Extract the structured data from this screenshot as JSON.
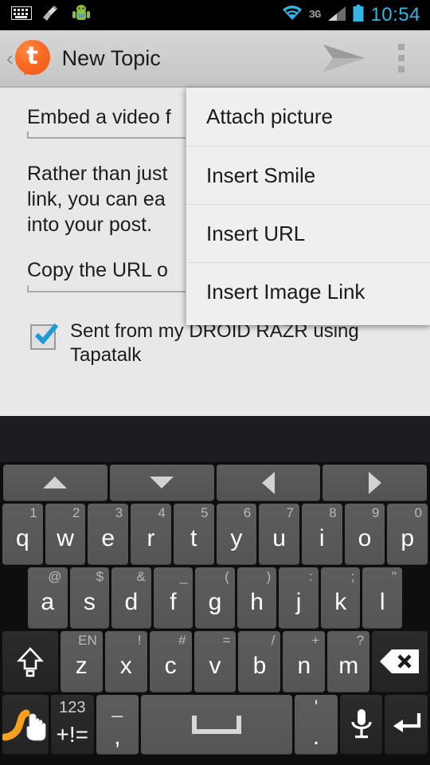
{
  "status_bar": {
    "left_icons": [
      "keyboard-icon",
      "broom-icon",
      "android-robot-icon"
    ],
    "wifi_icon": "wifi-icon",
    "network_label": "3G",
    "signal_icon": "signal-bars-icon",
    "battery_icon": "battery-icon",
    "time": "10:54",
    "accent_color": "#33b5e5"
  },
  "action_bar": {
    "back_label": "‹",
    "logo_letter": "t",
    "logo_name": "tapatalk-logo",
    "logo_color": "#f4601c",
    "title": "New Topic",
    "send_label": "send-icon",
    "overflow_label": "overflow-menu-icon"
  },
  "compose": {
    "subject": "Embed a video f",
    "body_lines": [
      "Rather than just",
      "link, you can ea",
      "into your post."
    ],
    "url_field": "Copy the URL o",
    "signature_checked": true,
    "signature_label": "Sent from my DROID RAZR using Tapatalk"
  },
  "overflow_menu": {
    "items": [
      {
        "label": "Attach picture"
      },
      {
        "label": "Insert Smile"
      },
      {
        "label": "Insert URL"
      },
      {
        "label": "Insert Image Link"
      }
    ]
  },
  "keyboard": {
    "nav_keys": [
      {
        "name": "arrow-up-key"
      },
      {
        "name": "arrow-down-key"
      },
      {
        "name": "arrow-left-key"
      },
      {
        "name": "arrow-right-key"
      }
    ],
    "row1": [
      {
        "main": "q",
        "alt": "1"
      },
      {
        "main": "w",
        "alt": "2"
      },
      {
        "main": "e",
        "alt": "3"
      },
      {
        "main": "r",
        "alt": "4"
      },
      {
        "main": "t",
        "alt": "5"
      },
      {
        "main": "y",
        "alt": "6"
      },
      {
        "main": "u",
        "alt": "7"
      },
      {
        "main": "i",
        "alt": "8"
      },
      {
        "main": "o",
        "alt": "9"
      },
      {
        "main": "p",
        "alt": "0"
      }
    ],
    "row2": [
      {
        "main": "a",
        "alt": "@"
      },
      {
        "main": "s",
        "alt": "$"
      },
      {
        "main": "d",
        "alt": "&"
      },
      {
        "main": "f",
        "alt": "_"
      },
      {
        "main": "g",
        "alt": "("
      },
      {
        "main": "h",
        "alt": ")"
      },
      {
        "main": "j",
        "alt": ":"
      },
      {
        "main": "k",
        "alt": ";"
      },
      {
        "main": "l",
        "alt": "\""
      }
    ],
    "row3": [
      {
        "main": "z",
        "alt": "EN"
      },
      {
        "main": "x",
        "alt": "!"
      },
      {
        "main": "c",
        "alt": "#"
      },
      {
        "main": "v",
        "alt": "="
      },
      {
        "main": "b",
        "alt": "/"
      },
      {
        "main": "n",
        "alt": "+"
      },
      {
        "main": "m",
        "alt": "?"
      }
    ],
    "shift_key": "shift-key",
    "backspace_key": "backspace-key",
    "swipe_key": "swipe-gesture-key",
    "symbols_key": {
      "top": "123",
      "bottom": "+!="
    },
    "comma_key": {
      "top": "_",
      "bottom": ","
    },
    "space_key": "space-key",
    "period_key": {
      "top": "'",
      "bottom": "."
    },
    "mic_key": "microphone-key",
    "enter_key": "enter-key"
  }
}
